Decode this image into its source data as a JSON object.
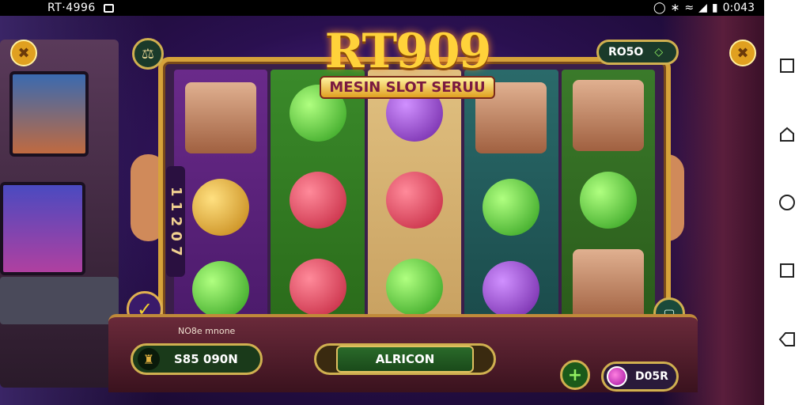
{
  "status_bar": {
    "left_text": "RT·4996",
    "right_text": "0:043"
  },
  "game": {
    "title": "RT909",
    "subtitle": "MESIN SLOT SERUU",
    "side_numbers": "1 1 2 0 7"
  },
  "top_bar": {
    "pill_label": "RO5O"
  },
  "console": {
    "small_label": "NO8e mnone",
    "balance_value": "S85 090N",
    "spin_label": "ALRICON",
    "right_pill_label": "D05R"
  },
  "icons": {
    "top_left": "hammer-icon",
    "top_left2": "shield-icon",
    "top_right": "tools-icon",
    "left_arrow": "arrow-icon",
    "right_square": "screen-icon",
    "plus": "plus-icon",
    "gem": "gem-icon"
  },
  "colors": {
    "gold": "#d6a23a",
    "green": "#1a3a1a",
    "purple": "#3a1a6a"
  }
}
